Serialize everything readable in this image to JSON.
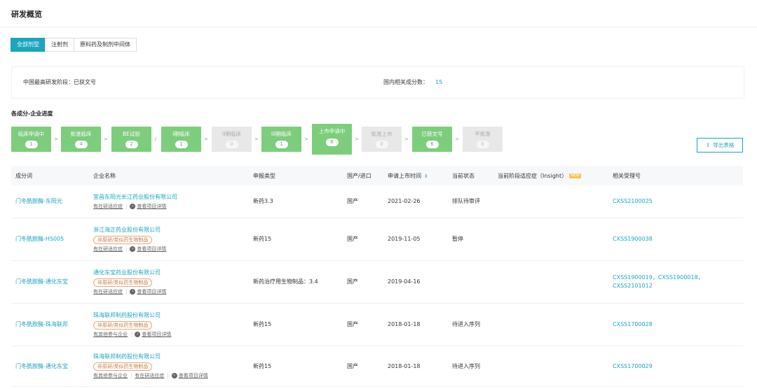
{
  "page_title": "研发概览",
  "tabs": [
    {
      "label": "全部剂型",
      "active": true
    },
    {
      "label": "注射剂",
      "active": false
    },
    {
      "label": "原料药及制剂中间体",
      "active": false
    }
  ],
  "summary": {
    "highest_stage": "中国最高研发阶段：已获文号",
    "related_label": "国内相关成分数：",
    "related_count": "15"
  },
  "section_title": "各成分-企业进度",
  "stages": [
    {
      "label": "临床申请中",
      "count": "1"
    },
    {
      "label": "批准临床",
      "count": "4"
    },
    {
      "label": "BE试验",
      "count": "2"
    },
    {
      "label": "I期临床",
      "count": "1"
    },
    {
      "label": "II期临床",
      "count": "0"
    },
    {
      "label": "III期临床",
      "count": "1"
    },
    {
      "label": "上市申请中",
      "count": "6"
    },
    {
      "label": "批准上市",
      "count": "0"
    },
    {
      "label": "已获文号",
      "count": "6"
    },
    {
      "label": "不批准",
      "count": "0"
    }
  ],
  "separator": "/",
  "export_label": "导出表格",
  "table": {
    "headers": {
      "component": "成分词",
      "company": "企业名称",
      "type": "申报类型",
      "origin": "国产/进口",
      "date": "申请上市时间",
      "status": "当前状态",
      "indication": "当前阶段适应症（Insight）",
      "new_badge": "NEW",
      "accept_no": "相关受理号"
    },
    "rows": [
      {
        "component": "门冬酰胺酶-东阳光",
        "company": "宜昌东阳光长江药业股份有限公司",
        "tag": "",
        "sub_a": "",
        "sub_b": "有在研适应症",
        "sub_c": "查看项目详情",
        "type": "新药3.3",
        "origin": "国产",
        "date": "2021-02-26",
        "status": "排队待审评",
        "accept_no": "CXSS2100025"
      },
      {
        "component": "门冬酰胺酶-HS005",
        "company": "浙江海正药业股份有限公司",
        "tag": "非原研/类似药生物制品",
        "sub_a": "",
        "sub_b": "有在研适应症",
        "sub_c": "查看项目详情",
        "type": "新药15",
        "origin": "国产",
        "date": "2019-11-05",
        "status": "暂停",
        "accept_no": "CXSS1900038"
      },
      {
        "component": "门冬酰胺酶-通化东宝",
        "company": "通化东宝药业股份有限公司",
        "tag": "非原研/类似药生物制品",
        "sub_a": "",
        "sub_b": "有在研适应症",
        "sub_c": "查看项目详情",
        "type": "新药治疗用生物制品：3.4",
        "origin": "国产",
        "date": "2019-04-16",
        "status": "",
        "accept_no": "CXSS1900019，CXSS1900018，CXSS2101012"
      },
      {
        "component": "门冬酰胺酶-珠海联邦",
        "company": "珠海联邦制药股份有限公司",
        "tag": "非原研/类似药生物制品",
        "sub_a": "有其他参与企业",
        "sub_b": "",
        "sub_c": "查看项目详情",
        "type": "新药15",
        "origin": "国产",
        "date": "2018-01-18",
        "status": "待进入序列",
        "accept_no": "CXSS1700028"
      },
      {
        "component": "门冬酰胺酶-通化东宝",
        "company": "珠海联邦制药股份有限公司",
        "tag": "非原研/类似药生物制品",
        "sub_a": "有其他参与企业",
        "sub_b": "有在研适应症",
        "sub_c": "查看项目详情",
        "type": "新药15",
        "origin": "国产",
        "date": "2018-01-18",
        "status": "待进入序列",
        "accept_no": "CXSS1700029"
      }
    ]
  },
  "colors": {
    "accent": "#1ba6bd",
    "stage_active": "#7ccd7c",
    "stage_inactive": "#e8e8e8",
    "tag_border": "#e8a77a"
  }
}
